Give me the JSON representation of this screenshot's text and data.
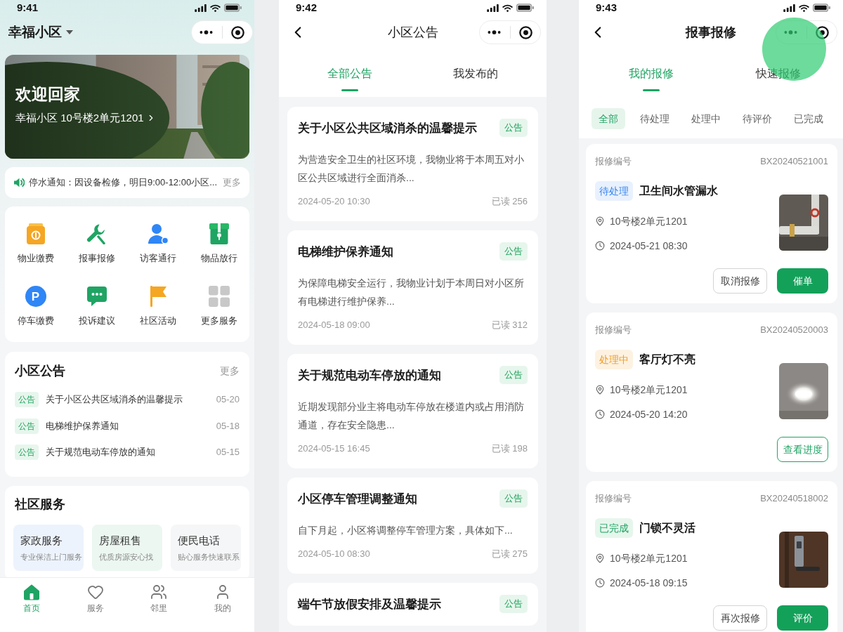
{
  "home_screen": {
    "status_bar": {
      "time": "9:41"
    },
    "community_selector": "幸福小区",
    "banner": {
      "title": "欢迎回家",
      "address": "幸福小区 10号楼2单元1201"
    },
    "notice_bar": {
      "text": "停水通知：因设备检修，明日9:00-12:00小区...",
      "more": "更多"
    },
    "services": [
      {
        "label": "物业缴费"
      },
      {
        "label": "报事报修"
      },
      {
        "label": "访客通行"
      },
      {
        "label": "物品放行"
      },
      {
        "label": "停车缴费",
        "icon_text": "P"
      },
      {
        "label": "投诉建议"
      },
      {
        "label": "社区活动"
      },
      {
        "label": "更多服务"
      }
    ],
    "announcements": {
      "title": "小区公告",
      "more": "更多",
      "items": [
        {
          "tag": "公告",
          "title": "关于小区公共区域消杀的温馨提示",
          "date": "05-20"
        },
        {
          "tag": "公告",
          "title": "电梯维护保养通知",
          "date": "05-18"
        },
        {
          "tag": "公告",
          "title": "关于规范电动车停放的通知",
          "date": "05-15"
        }
      ]
    },
    "community_services": {
      "title": "社区服务",
      "tiles": [
        {
          "title": "家政服务",
          "subtitle": "专业保洁上门服务"
        },
        {
          "title": "房屋租售",
          "subtitle": "优质房源安心找"
        },
        {
          "title": "便民电话",
          "subtitle": "贴心服务快速联系"
        }
      ]
    },
    "tab_bar": [
      {
        "label": "首页",
        "selected": true
      },
      {
        "label": "服务",
        "selected": false
      },
      {
        "label": "邻里",
        "selected": false
      },
      {
        "label": "我的",
        "selected": false
      }
    ]
  },
  "notice_screen": {
    "status_bar": {
      "time": "9:42"
    },
    "title": "小区公告",
    "tabs": [
      {
        "label": "全部公告",
        "selected": true
      },
      {
        "label": "我发布的",
        "selected": false
      }
    ],
    "notices": [
      {
        "title": "关于小区公共区域消杀的温馨提示",
        "tag": "公告",
        "summary": "为营造安全卫生的社区环境，我物业将于本周五对小区公共区域进行全面消杀...",
        "time": "2024-05-20 10:30",
        "reads": "已读 256"
      },
      {
        "title": "电梯维护保养通知",
        "tag": "公告",
        "summary": "为保障电梯安全运行，我物业计划于本周日对小区所有电梯进行维护保养...",
        "time": "2024-05-18 09:00",
        "reads": "已读 312"
      },
      {
        "title": "关于规范电动车停放的通知",
        "tag": "公告",
        "summary": "近期发现部分业主将电动车停放在楼道内或占用消防通道，存在安全隐患...",
        "time": "2024-05-15 16:45",
        "reads": "已读 198"
      },
      {
        "title": "小区停车管理调整通知",
        "tag": "公告",
        "summary": "自下月起，小区将调整停车管理方案，具体如下...",
        "time": "2024-05-10 08:30",
        "reads": "已读 275"
      },
      {
        "title": "端午节放假安排及温馨提示",
        "tag": "公告"
      }
    ]
  },
  "repair_screen": {
    "status_bar": {
      "time": "9:43"
    },
    "title": "报事报修",
    "tap_highlight": true,
    "tabs": [
      {
        "label": "我的报修",
        "selected": true
      },
      {
        "label": "快速报修",
        "selected": false
      }
    ],
    "filters": [
      {
        "label": "全部",
        "selected": true
      },
      {
        "label": "待处理",
        "selected": false
      },
      {
        "label": "处理中",
        "selected": false
      },
      {
        "label": "待评价",
        "selected": false
      },
      {
        "label": "已完成",
        "selected": false
      }
    ],
    "orders": [
      {
        "number_label": "报修编号",
        "number": "BX20240521001",
        "status": {
          "label": "待处理",
          "kind": "pending"
        },
        "title": "卫生间水管漏水",
        "location": "10号楼2单元1201",
        "time": "2024-05-21 08:30",
        "actions": [
          {
            "label": "取消报修",
            "kind": "secondary"
          },
          {
            "label": "催单",
            "kind": "primary"
          }
        ]
      },
      {
        "number_label": "报修编号",
        "number": "BX20240520003",
        "status": {
          "label": "处理中",
          "kind": "processing"
        },
        "title": "客厅灯不亮",
        "location": "10号楼2单元1201",
        "time": "2024-05-20 14:20",
        "actions": [
          {
            "label": "查看进度",
            "kind": "outline"
          }
        ]
      },
      {
        "number_label": "报修编号",
        "number": "BX20240518002",
        "status": {
          "label": "已完成",
          "kind": "completed"
        },
        "title": "门锁不灵活",
        "location": "10号楼2单元1201",
        "time": "2024-05-18 09:15",
        "actions": [
          {
            "label": "再次报修",
            "kind": "secondary"
          },
          {
            "label": "评价",
            "kind": "primary"
          }
        ]
      }
    ]
  }
}
